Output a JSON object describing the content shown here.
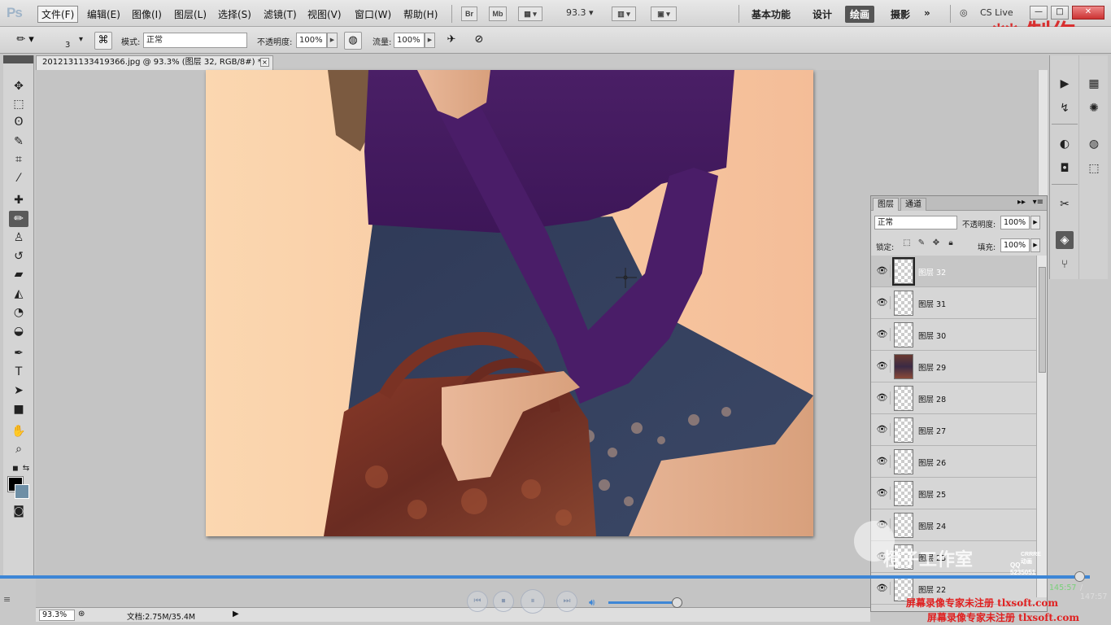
{
  "app": {
    "logo": "Ps",
    "menus": [
      "文件(F)",
      "编辑(E)",
      "图像(I)",
      "图层(L)",
      "选择(S)",
      "滤镜(T)",
      "视图(V)",
      "窗口(W)",
      "帮助(H)"
    ],
    "bridge_label": "Br",
    "minibridge_label": "Mb",
    "zoom_value": "93.3",
    "workspaces": [
      "基本功能",
      "设计",
      "绘画",
      "摄影"
    ],
    "active_workspace": "绘画",
    "more_label": "»",
    "cs_live": "CS Live",
    "window_buttons": [
      "—",
      "□",
      "✕"
    ],
    "watermark_title": "** 制作"
  },
  "options": {
    "brush_size": "3",
    "mode_label": "模式:",
    "mode_value": "正常",
    "opacity_label": "不透明度:",
    "opacity_value": "100%",
    "flow_label": "流量:",
    "flow_value": "100%"
  },
  "document": {
    "tab_title": "2012131133419366.jpg @ 93.3% (图层 32, RGB/8#) *",
    "close_label": "×"
  },
  "tools": [
    {
      "icon": "move-icon",
      "glyph": "✥"
    },
    {
      "icon": "marquee-icon",
      "glyph": "⬚"
    },
    {
      "icon": "lasso-icon",
      "glyph": "ʘ"
    },
    {
      "icon": "quick-select-icon",
      "glyph": "✎"
    },
    {
      "icon": "crop-icon",
      "glyph": "⌗"
    },
    {
      "icon": "eyedropper-icon",
      "glyph": "⁄"
    },
    {
      "icon": "healing-brush-icon",
      "glyph": "✚"
    },
    {
      "icon": "brush-icon",
      "glyph": "✏"
    },
    {
      "icon": "clone-stamp-icon",
      "glyph": "♙"
    },
    {
      "icon": "history-brush-icon",
      "glyph": "↺"
    },
    {
      "icon": "eraser-icon",
      "glyph": "▰"
    },
    {
      "icon": "paint-bucket-icon",
      "glyph": "◭"
    },
    {
      "icon": "blur-icon",
      "glyph": "◔"
    },
    {
      "icon": "dodge-icon",
      "glyph": "◒"
    },
    {
      "icon": "pen-icon",
      "glyph": "✒"
    },
    {
      "icon": "type-icon",
      "glyph": "T"
    },
    {
      "icon": "path-select-icon",
      "glyph": "➤"
    },
    {
      "icon": "rectangle-shape-icon",
      "glyph": "■"
    },
    {
      "icon": "hand-icon",
      "glyph": "✋"
    },
    {
      "icon": "zoom-icon",
      "glyph": "⌕"
    }
  ],
  "selected_tool": "brush-icon",
  "colors": {
    "foreground": "#000000",
    "background": "#6e8fa6",
    "accent": "#3d86d6"
  },
  "layers_panel": {
    "tabs": [
      "图层",
      "通道"
    ],
    "blend_mode": "正常",
    "opacity_label": "不透明度:",
    "opacity_value": "100%",
    "lock_label": "锁定:",
    "fill_label": "填充:",
    "fill_value": "100%",
    "layers": [
      {
        "name": "图层 32",
        "selected": true,
        "thumb": "transparent"
      },
      {
        "name": "图层 31",
        "selected": false,
        "thumb": "transparent"
      },
      {
        "name": "图层 30",
        "selected": false,
        "thumb": "transparent"
      },
      {
        "name": "图层 29",
        "selected": false,
        "thumb": "photo"
      },
      {
        "name": "图层 28",
        "selected": false,
        "thumb": "transparent"
      },
      {
        "name": "图层 27",
        "selected": false,
        "thumb": "transparent"
      },
      {
        "name": "图层 26",
        "selected": false,
        "thumb": "transparent"
      },
      {
        "name": "图层 25",
        "selected": false,
        "thumb": "transparent"
      },
      {
        "name": "图层 24",
        "selected": false,
        "thumb": "transparent"
      },
      {
        "name": "图层 23",
        "selected": false,
        "thumb": "transparent"
      },
      {
        "name": "图层 22",
        "selected": false,
        "thumb": "transparent"
      }
    ]
  },
  "status": {
    "zoom": "93.3%",
    "doc_info": "文档:2.75M/35.4M"
  },
  "player": {
    "progress": 0.99,
    "volume": 0.93,
    "time_current": "145:57",
    "time_total": "/ 147:57",
    "studio_watermark": "橙子工作室",
    "studio_brand": "CRRRE动画",
    "studio_qq": "QQ 5235051",
    "registration_note_1": "屏幕录像专家未注册 tlxsoft.com",
    "registration_note_2": "屏幕录像专家未注册 tlxsoft.com"
  }
}
